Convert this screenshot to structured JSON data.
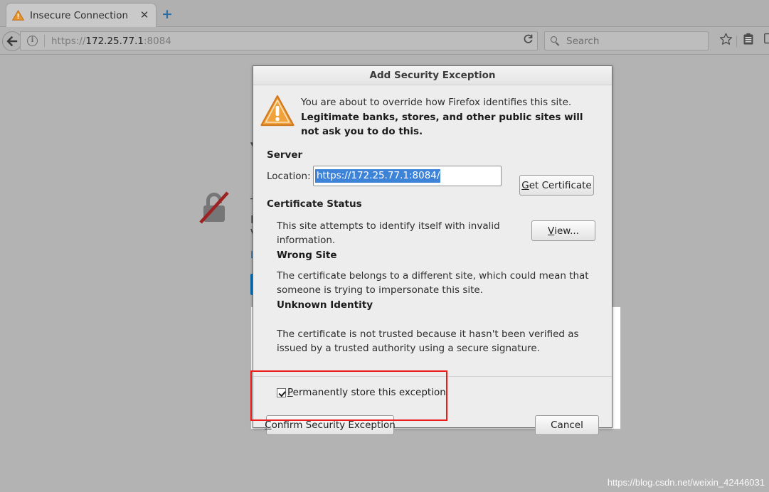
{
  "browser": {
    "tab": {
      "title": "Insecure Connection",
      "warning_icon": "warning-triangle-icon",
      "close_label": "✕"
    },
    "new_tab_label": "+",
    "back_label": "←",
    "identity_label": "i",
    "url": {
      "scheme": "https://",
      "host": "172.25.77.1",
      "port": ":8084"
    },
    "reload_label": "⟳",
    "search": {
      "placeholder": "Search",
      "icon": "search-icon"
    },
    "toolbar_icons": {
      "bookmark": "☆",
      "library": "library-icon",
      "edge": "sidebar-icon"
    }
  },
  "page_background": {
    "lock_icon": "broken-lock-icon",
    "fragments": [
      "▼",
      "T",
      "F",
      "V"
    ],
    "link_fragment": "L"
  },
  "dialog": {
    "title": "Add Security Exception",
    "warning_icon": "warning-triangle-icon",
    "intro_line": "You are about to override how Firefox identifies this site.",
    "intro_bold": "Legitimate banks, stores, and other public sites will not ask you to do this.",
    "server_heading": "Server",
    "location_label": "Location:",
    "location_value": "https://172.25.77.1:8084/",
    "get_certificate": {
      "accel": "G",
      "rest": "et Certificate"
    },
    "certificate_status_heading": "Certificate Status",
    "status_text": "This site attempts to identify itself with invalid information.",
    "status_title": "Wrong Site",
    "view_button": {
      "accel": "V",
      "prefix": "",
      "rest": "iew..."
    },
    "paragraph_1": "The certificate belongs to a different site, which could mean that someone is trying to impersonate this site.",
    "paragraph_1_title": "Unknown Identity",
    "paragraph_2": "The certificate is not trusted because it hasn't been verified as issued by a trusted authority using a secure signature.",
    "checkbox": {
      "checked": true,
      "accel": "P",
      "rest": "ermanently store this exception"
    },
    "confirm_button": {
      "accel": "C",
      "rest": "onfirm Security Exception"
    },
    "cancel_button": "Cancel"
  },
  "annotation": {
    "highlight_color": "#ee1b1b"
  },
  "watermark": "https://blog.csdn.net/weixin_42446031"
}
